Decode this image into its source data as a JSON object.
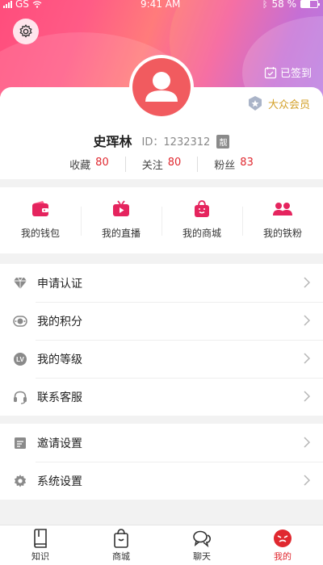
{
  "status_bar": {
    "carrier": "GS",
    "time": "9:41 AM",
    "battery_text": "58 %"
  },
  "header": {
    "checkin_label": "已签到"
  },
  "profile": {
    "member_level": "大众会员",
    "name": "史珲林",
    "id_label": "ID：",
    "id_value": "1232312",
    "id_badge": "靓",
    "stats": [
      {
        "label": "收藏",
        "value": "80"
      },
      {
        "label": "关注",
        "value": "80"
      },
      {
        "label": "粉丝",
        "value": "83"
      }
    ]
  },
  "quick_actions": [
    {
      "label": "我的钱包",
      "icon": "wallet-icon"
    },
    {
      "label": "我的直播",
      "icon": "tv-icon"
    },
    {
      "label": "我的商城",
      "icon": "shopping-bag-icon"
    },
    {
      "label": "我的铁粉",
      "icon": "fans-icon"
    }
  ],
  "menu_group_1": [
    {
      "label": "申请认证",
      "icon": "diamond-icon"
    },
    {
      "label": "我的积分",
      "icon": "points-icon"
    },
    {
      "label": "我的等级",
      "icon": "level-icon"
    },
    {
      "label": "联系客服",
      "icon": "headset-icon"
    }
  ],
  "menu_group_2": [
    {
      "label": "邀请设置",
      "icon": "invite-icon"
    },
    {
      "label": "系统设置",
      "icon": "gear-icon"
    }
  ],
  "tabs": [
    {
      "label": "知识",
      "icon": "book-icon"
    },
    {
      "label": "商城",
      "icon": "bag-icon"
    },
    {
      "label": "聊天",
      "icon": "chat-icon"
    },
    {
      "label": "我的",
      "icon": "me-icon",
      "active": true
    }
  ],
  "colors": {
    "accent": "#e0282f",
    "gold": "#d4a12a",
    "avatar": "#f15b5f"
  }
}
